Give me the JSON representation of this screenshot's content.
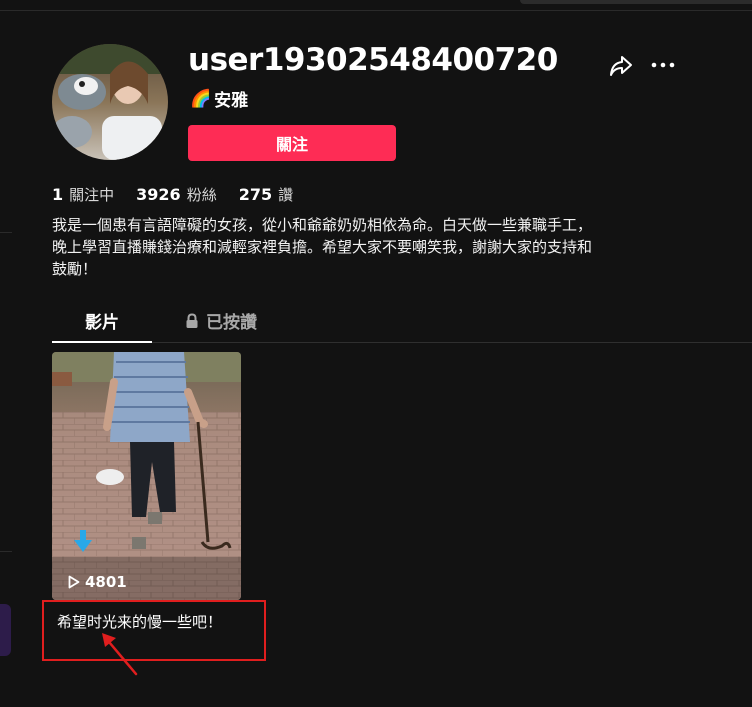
{
  "profile": {
    "username": "user19302548400720",
    "nickname_emoji": "🌈",
    "nickname": "安雅",
    "follow_label": "關注",
    "share_icon": "share-arrow-icon",
    "more_icon": "more-dots-icon"
  },
  "stats": [
    {
      "value": "1",
      "label": "關注中"
    },
    {
      "value": "3926",
      "label": "粉絲"
    },
    {
      "value": "275",
      "label": "讚"
    }
  ],
  "bio": "我是一個患有言語障礙的女孩，從小和爺爺奶奶相依為命。白天做一些兼職手工，晚上學習直播賺錢治療和減輕家裡負擔。希望大家不要嘲笑我，謝謝大家的支持和鼓勵！",
  "tabs": [
    {
      "label": "影片",
      "active": true
    },
    {
      "label": "已按讚",
      "active": false,
      "icon": "lock-icon"
    }
  ],
  "videos": [
    {
      "play_count": "4801",
      "caption": "希望时光来的慢一些吧！"
    }
  ],
  "colors": {
    "background": "#121212",
    "accent": "#fe2c55",
    "annotation": "#e01e1e"
  }
}
